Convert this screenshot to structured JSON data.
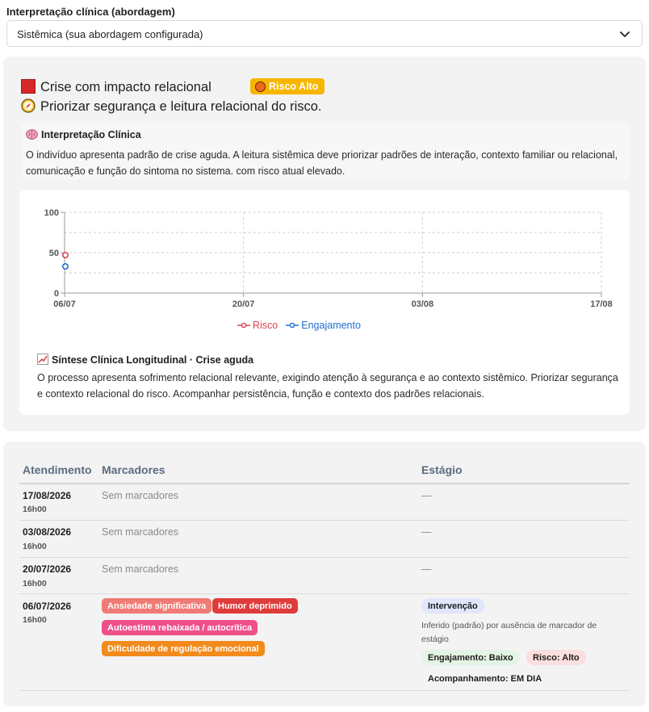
{
  "selector": {
    "label": "Interpretação clínica (abordagem)",
    "value": "Sistêmica (sua abordagem configurada)",
    "icon": "chevron-down-icon"
  },
  "summary": {
    "headline": "Crise com impacto relacional",
    "risk_badge": "Risco Alto",
    "guidance": "Priorizar segurança e leitura relacional do risco.",
    "colors": {
      "risk_badge": "#f7b500",
      "headline_square": "#d62828"
    }
  },
  "interpretation": {
    "title": "Interpretação Clínica",
    "text": "O indivíduo apresenta padrão de crise aguda. A leitura sistêmica deve priorizar padrões de interação, contexto familiar ou relacional, comunicação e função do sintoma no sistema. com risco atual elevado."
  },
  "chart_data": {
    "type": "line",
    "x": [
      "06/07",
      "20/07",
      "03/08",
      "17/08"
    ],
    "ylim": [
      0,
      100
    ],
    "y_ticks": [
      "100",
      "50",
      "0"
    ],
    "grid": true,
    "legend_position": "bottom-center",
    "series": [
      {
        "name": "Risco",
        "color": "#d9434f",
        "values": [
          47,
          null,
          null,
          null
        ]
      },
      {
        "name": "Engajamento",
        "color": "#1f6fd6",
        "values": [
          33,
          null,
          null,
          null
        ]
      }
    ]
  },
  "synthesis": {
    "title": "Síntese Clínica Longitudinal · Crise aguda",
    "text": "O processo apresenta sofrimento relacional relevante, exigindo atenção à segurança e ao contexto sistêmico. Priorizar segurança e contexto relacional do risco. Acompanhar persistência, função e contexto dos padrões relacionais."
  },
  "table": {
    "headers": {
      "session": "Atendimento",
      "markers": "Marcadores",
      "stage": "Estágio"
    },
    "rows": [
      {
        "date": "17/08/2026",
        "time": "16h00",
        "markers": "Sem marcadores",
        "stage": "—"
      },
      {
        "date": "03/08/2026",
        "time": "16h00",
        "markers": "Sem marcadores",
        "stage": "—"
      },
      {
        "date": "20/07/2026",
        "time": "16h00",
        "markers": "Sem marcadores",
        "stage": "—"
      }
    ],
    "last_row": {
      "date": "06/07/2026",
      "time": "16h00",
      "tags": [
        {
          "label": "Ansiedade significativa",
          "color": "#f07a74"
        },
        {
          "label": "Humor deprimido",
          "color": "#df3b3b"
        },
        {
          "label": "Autoestima rebaixada / autocrítica",
          "color": "#f0508a"
        },
        {
          "label": "Dificuldade de regulação emocional",
          "color": "#f28a1c"
        }
      ],
      "stage_pill": "Intervenção",
      "stage_note": "Inferido (padrão) por ausência de marcador de estágio",
      "engagement": "Engajamento: Baixo",
      "risk": "Risco: Alto",
      "followup": "Acompanhamento: EM DIA"
    }
  }
}
